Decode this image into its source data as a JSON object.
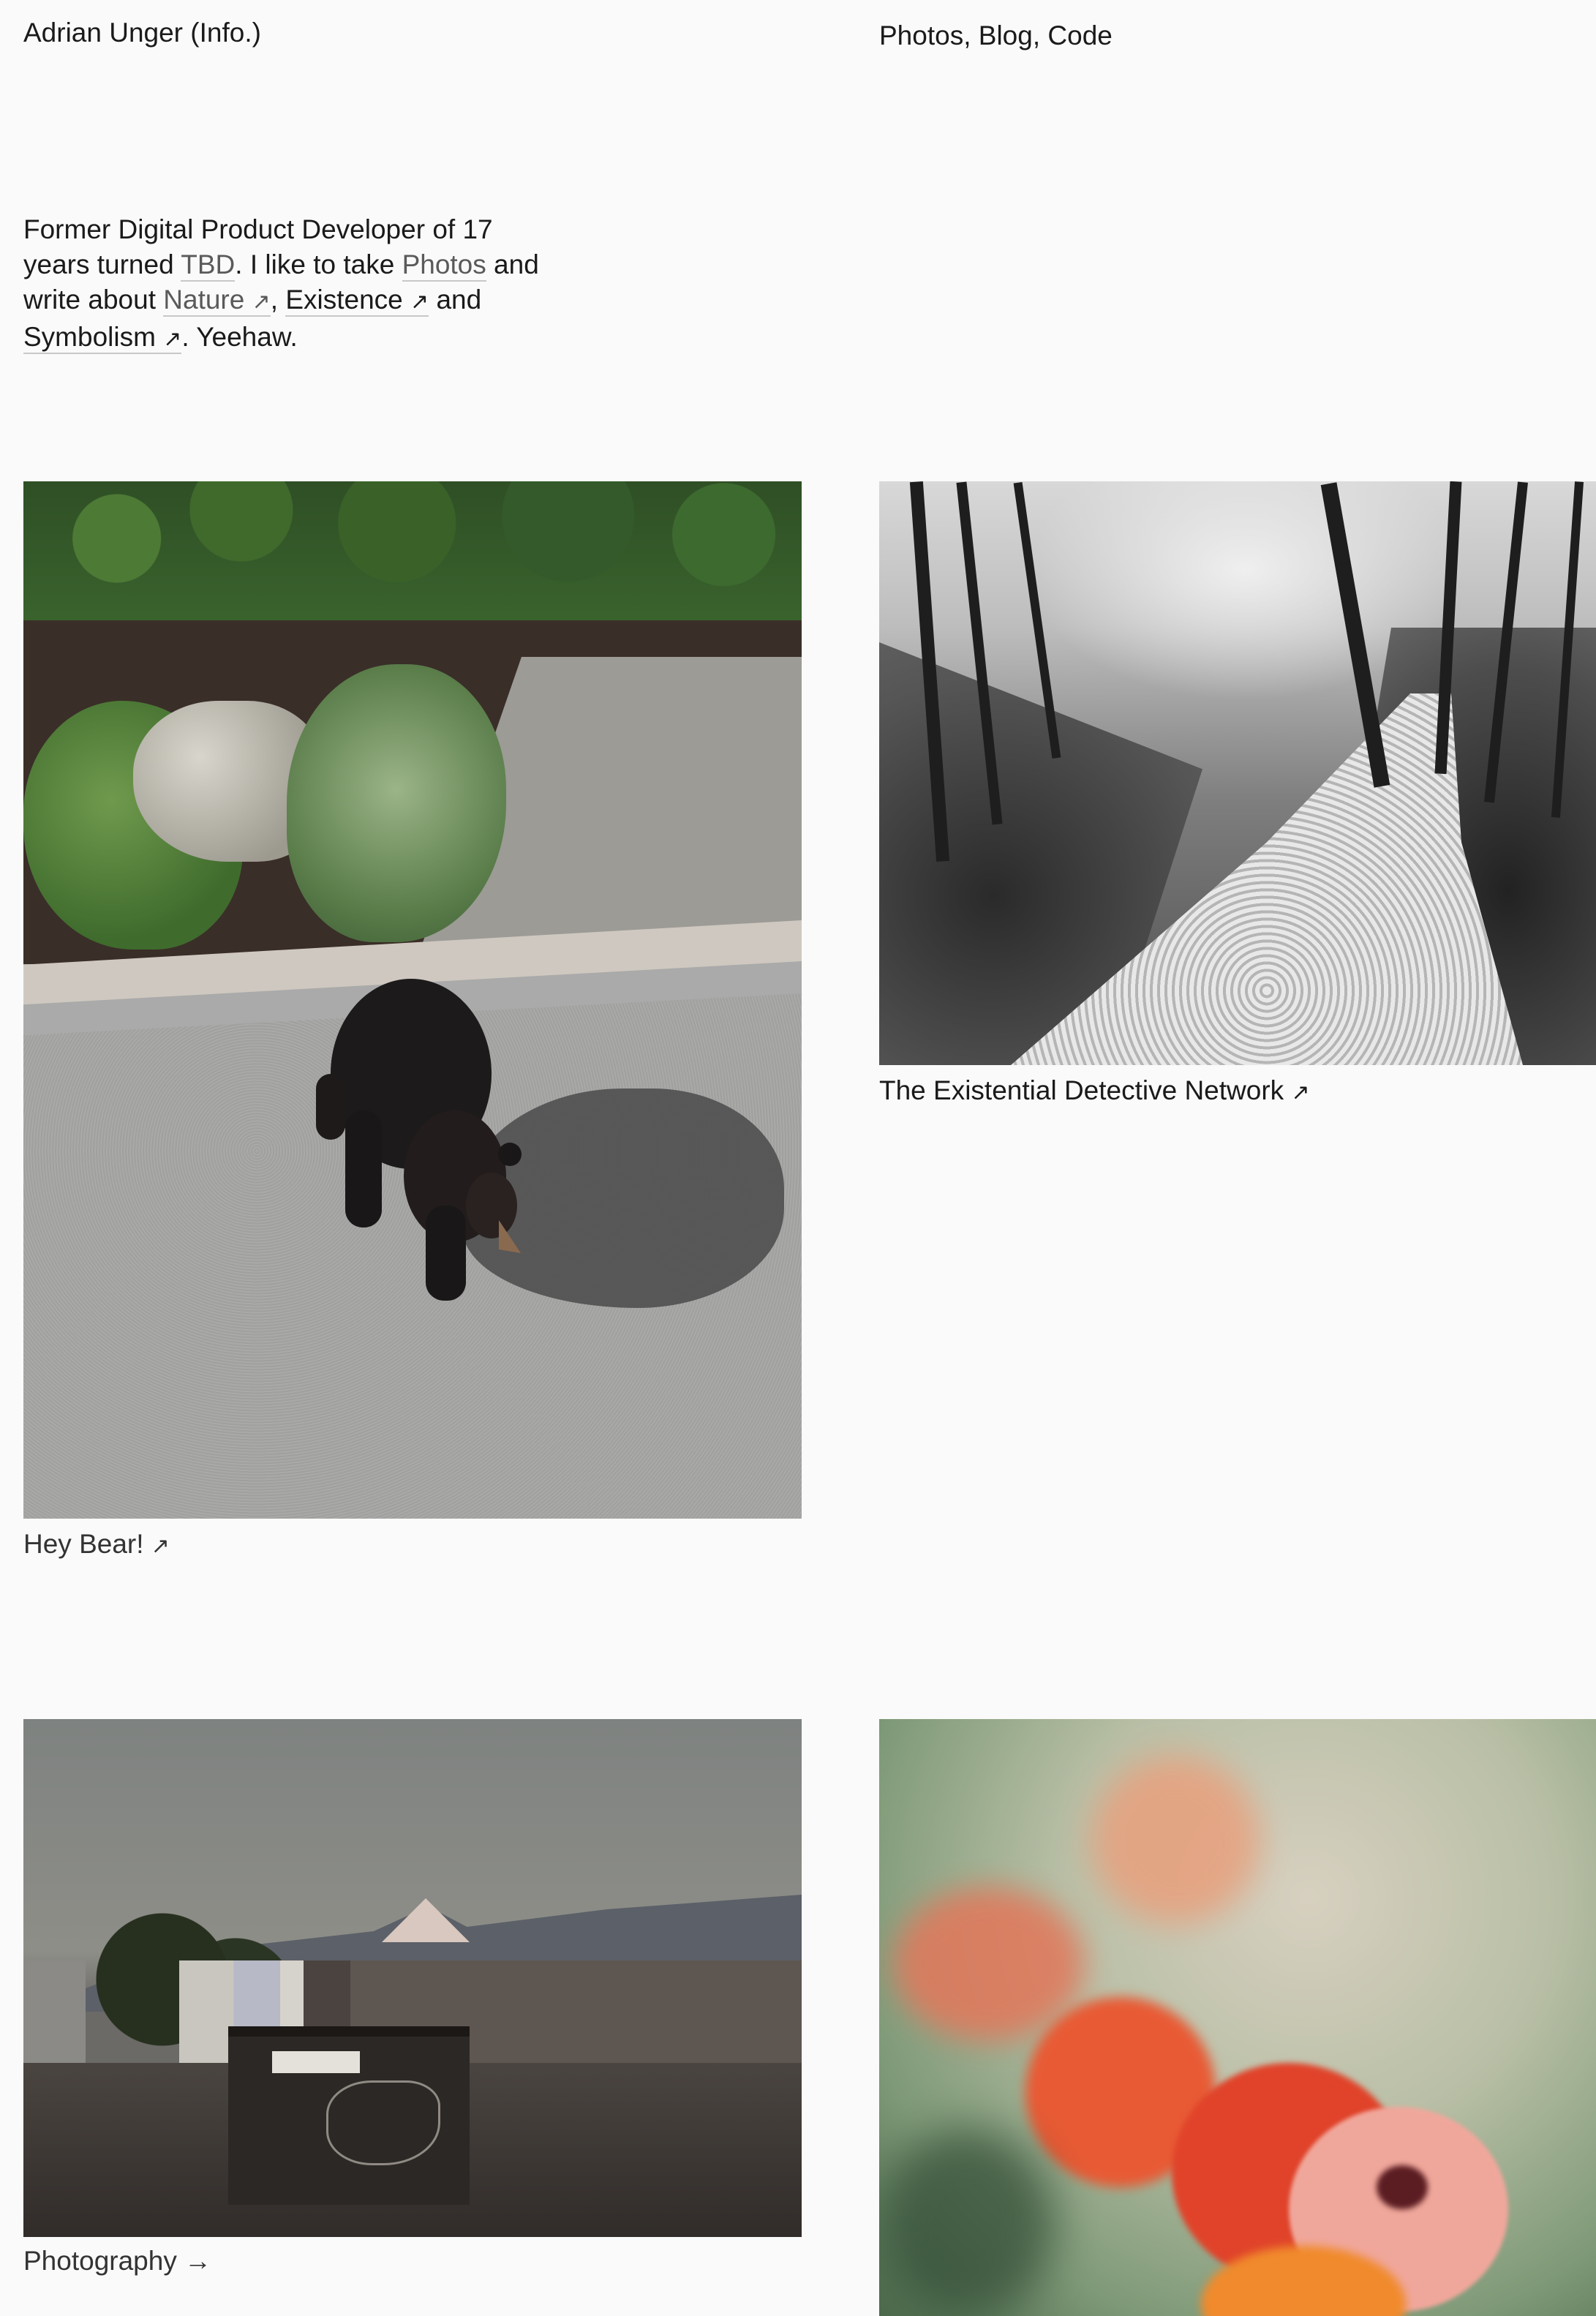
{
  "header": {
    "title": "Adrian Unger (Info.)",
    "nav": {
      "photos": "Photos",
      "sep1": ", ",
      "blog": "Blog",
      "sep2": ", ",
      "code": "Code"
    }
  },
  "intro": {
    "t1": "Former Digital Product Developer of 17 years turned ",
    "link_tbd": "TBD",
    "t2": ". I like to take ",
    "link_photos": "Photos",
    "t3": " and write about ",
    "link_nature": "Nature",
    "t4": ", ",
    "link_existence": "Existence",
    "t5": " and ",
    "link_symbolism": "Symbolism",
    "t6": ". Yeehaw.",
    "external_arrow": "↗"
  },
  "posts": [
    {
      "caption": "Hey Bear!",
      "suffix": "↗"
    },
    {
      "caption": "The Existential Detective Network",
      "suffix": "↗"
    },
    {
      "caption": "Photography",
      "suffix": "→"
    },
    {
      "caption": "",
      "suffix": ""
    }
  ],
  "icons": {
    "external": "external-link-icon",
    "arrow": "arrow-right-icon"
  },
  "colors": {
    "background": "#fafafa",
    "text": "#1a1a1a",
    "link_muted": "#5a5a5a",
    "underline": "#c8c8c8"
  }
}
